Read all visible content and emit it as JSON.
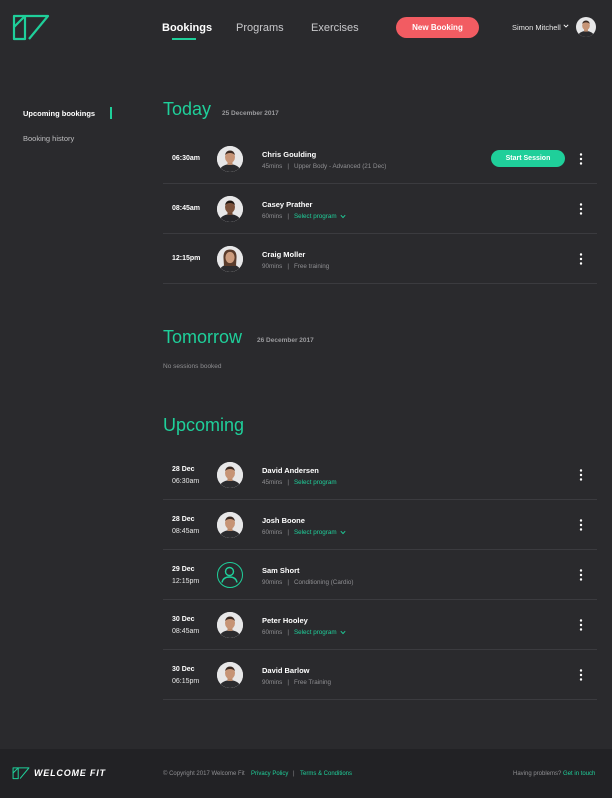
{
  "colors": {
    "accent": "#1fcf9a",
    "primary_button": "#f25c62",
    "background": "#2a2a2d"
  },
  "header": {
    "nav": [
      {
        "label": "Bookings"
      },
      {
        "label": "Programs"
      },
      {
        "label": "Exercises"
      }
    ],
    "new_booking_label": "New Booking",
    "user_name": "Simon Mitchell"
  },
  "sidebar": {
    "items": [
      {
        "label": "Upcoming bookings"
      },
      {
        "label": "Booking history"
      }
    ]
  },
  "today": {
    "title": "Today",
    "date": "25 December 2017",
    "bookings": [
      {
        "time": "06:30am",
        "name": "Chris Goulding",
        "duration": "45mins",
        "program": "Upper Body - Advanced (21 Dec)",
        "action": "Start Session"
      },
      {
        "time": "08:45am",
        "name": "Casey Prather",
        "duration": "60mins",
        "program": "Select program"
      },
      {
        "time": "12:15pm",
        "name": "Craig Moller",
        "duration": "90mins",
        "program": "Free training"
      }
    ]
  },
  "tomorrow": {
    "title": "Tomorrow",
    "date": "26 December 2017",
    "empty": "No sessions booked"
  },
  "upcoming": {
    "title": "Upcoming",
    "bookings": [
      {
        "day": "28 Dec",
        "time": "06:30am",
        "name": "David Andersen",
        "duration": "45mins",
        "program": "Select program"
      },
      {
        "day": "28 Dec",
        "time": "08:45am",
        "name": "Josh Boone",
        "duration": "60mins",
        "program": "Select program"
      },
      {
        "day": "29 Dec",
        "time": "12:15pm",
        "name": "Sam Short",
        "duration": "90mins",
        "program": "Conditioning (Cardio)"
      },
      {
        "day": "30 Dec",
        "time": "08:45am",
        "name": "Peter Hooley",
        "duration": "60mins",
        "program": "Select program"
      },
      {
        "day": "30 Dec",
        "time": "06:15pm",
        "name": "David Barlow",
        "duration": "90mins",
        "program": "Free Training"
      }
    ]
  },
  "footer": {
    "brand": "WELCOME FIT",
    "copyright": "© Copyright 2017 Welcome Fit",
    "privacy": "Privacy Policy",
    "sep": "|",
    "terms": "Terms & Conditions",
    "help_text": "Having problems?",
    "help_link": "Get in touch"
  }
}
